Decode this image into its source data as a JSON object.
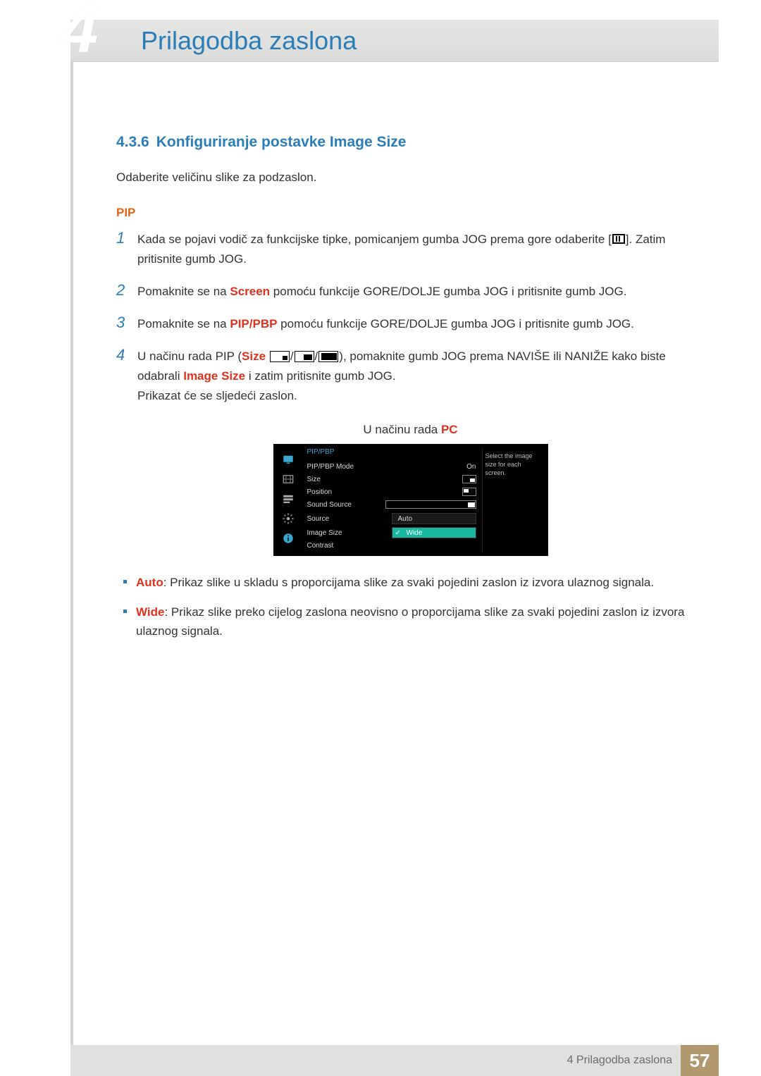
{
  "header": {
    "chapter_number_graphic": "4",
    "title": "Prilagodba zaslona"
  },
  "section": {
    "number": "4.3.6",
    "title": "Konfiguriranje postavke Image Size"
  },
  "intro": "Odaberite veličinu slike za podzaslon.",
  "subhead": "PIP",
  "steps": {
    "s1_a": "Kada se pojavi vodič za funkcijske tipke, pomicanjem gumba JOG prema gore odaberite [",
    "s1_b": "]. Zatim pritisnite gumb JOG.",
    "s2_a": "Pomaknite se na ",
    "s2_kw": "Screen",
    "s2_b": " pomoću funkcije GORE/DOLJE gumba JOG i pritisnite gumb JOG.",
    "s3_a": "Pomaknite se na ",
    "s3_kw": "PIP/PBP",
    "s3_b": " pomoću funkcije GORE/DOLJE gumba JOG i pritisnite gumb JOG.",
    "s4_a": "U načinu rada PIP (",
    "s4_kw_size": "Size",
    "s4_b": "), pomaknite gumb JOG prema NAVIŠE ili NANIŽE kako biste odabrali ",
    "s4_kw_image": "Image Size",
    "s4_c": " i zatim pritisnite gumb JOG.",
    "s4_d": "Prikazat će se sljedeći zaslon."
  },
  "caption_prefix": "U načinu rada ",
  "caption_mode": "PC",
  "osd": {
    "section": "PIP/PBP",
    "rows": {
      "mode": "PIP/PBP Mode",
      "mode_val": "On",
      "size": "Size",
      "position": "Position",
      "sound": "Sound Source",
      "source": "Source",
      "source_val": "Auto",
      "image_size": "Image Size",
      "image_size_val": "Wide",
      "contrast": "Contrast"
    },
    "help": "Select the image size for each screen."
  },
  "bullets": {
    "auto_kw": "Auto",
    "auto_text": ": Prikaz slike u skladu s proporcijama slike za svaki pojedini zaslon iz izvora ulaznog signala.",
    "wide_kw": "Wide",
    "wide_text": ": Prikaz slike preko cijelog zaslona neovisno o proporcijama slike za svaki pojedini zaslon iz izvora ulaznog signala."
  },
  "footer": {
    "label": "4 Prilagodba zaslona",
    "page": "57"
  }
}
